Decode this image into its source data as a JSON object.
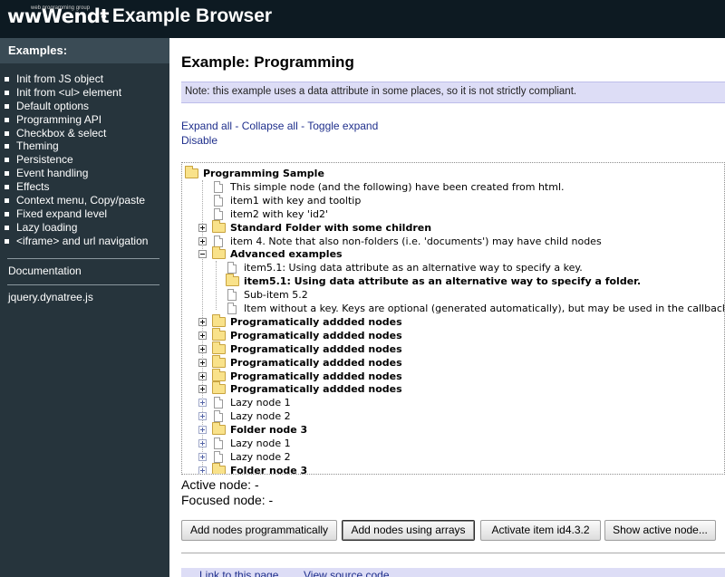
{
  "header": {
    "logo_text": "wwWendt",
    "logo_tag": "web programming group",
    "title": "- Example Browser"
  },
  "sidebar": {
    "heading": "Examples:",
    "items": [
      "Init from JS object",
      "Init from <ul> element",
      "Default options",
      "Programming API",
      "Checkbox & select",
      "Theming",
      "Persistence",
      "Event handling",
      "Effects",
      "Context menu, Copy/paste",
      "Fixed expand level",
      "Lazy loading",
      "<iframe> and url navigation"
    ],
    "documentation_link": "Documentation",
    "source_link": "jquery.dynatree.js"
  },
  "main": {
    "title": "Example: Programming",
    "note": "Note: this example uses a data attribute in some places, so it is not strictly compliant.",
    "links": {
      "expand_all": "Expand all",
      "separator": " - ",
      "collapse_all": "Collapse all",
      "toggle_expand": "Toggle expand",
      "disable": "Disable"
    },
    "tree": [
      {
        "title": "Programming Sample",
        "kind": "folder",
        "level": 0,
        "expander": "minus"
      },
      {
        "title": "This simple node (and the following) have been created from html.",
        "kind": "doc",
        "level": 1,
        "expander": "none"
      },
      {
        "title": "item1 with key and tooltip",
        "kind": "doc",
        "level": 1,
        "expander": "none"
      },
      {
        "title": "item2 with key 'id2'",
        "kind": "doc",
        "level": 1,
        "expander": "none"
      },
      {
        "title": "Standard Folder with some children",
        "kind": "folder",
        "level": 1,
        "expander": "plus"
      },
      {
        "title": "item 4. Note that also non-folders (i.e. 'documents') may have child nodes",
        "kind": "doc",
        "level": 1,
        "expander": "plus"
      },
      {
        "title": "Advanced examples",
        "kind": "folder",
        "level": 1,
        "expander": "minus"
      },
      {
        "title": "item5.1: Using data attribute as an alternative way to specify a key.",
        "kind": "doc",
        "level": 2,
        "expander": "none"
      },
      {
        "title": "item5.1: Using data attribute as an alternative way to specify a folder.",
        "kind": "folder",
        "level": 2,
        "expander": "none"
      },
      {
        "title": "Sub-item 5.2",
        "kind": "doc",
        "level": 2,
        "expander": "none"
      },
      {
        "title": "Item without a key. Keys are optional (generated automatically), but may be used in the callbacks",
        "kind": "doc",
        "level": 2,
        "expander": "none"
      },
      {
        "title": "Programatically addded nodes",
        "kind": "folder",
        "level": 1,
        "expander": "plus"
      },
      {
        "title": "Programatically addded nodes",
        "kind": "folder",
        "level": 1,
        "expander": "plus"
      },
      {
        "title": "Programatically addded nodes",
        "kind": "folder",
        "level": 1,
        "expander": "plus"
      },
      {
        "title": "Programatically addded nodes",
        "kind": "folder",
        "level": 1,
        "expander": "plus"
      },
      {
        "title": "Programatically addded nodes",
        "kind": "folder",
        "level": 1,
        "expander": "plus"
      },
      {
        "title": "Programatically addded nodes",
        "kind": "folder",
        "level": 1,
        "expander": "plus"
      },
      {
        "title": "Lazy node 1",
        "kind": "doc",
        "level": 1,
        "expander": "lazy"
      },
      {
        "title": "Lazy node 2",
        "kind": "doc",
        "level": 1,
        "expander": "lazy"
      },
      {
        "title": "Folder node 3",
        "kind": "folder",
        "level": 1,
        "expander": "lazy"
      },
      {
        "title": "Lazy node 1",
        "kind": "doc",
        "level": 1,
        "expander": "lazy"
      },
      {
        "title": "Lazy node 2",
        "kind": "doc",
        "level": 1,
        "expander": "lazy"
      },
      {
        "title": "Folder node 3",
        "kind": "folder",
        "level": 1,
        "expander": "lazy"
      }
    ],
    "active_node": "Active node: -",
    "focused_node": "Focused node: -",
    "buttons": {
      "add_programmatically": "Add nodes programmatically",
      "add_arrays": "Add nodes using arrays",
      "activate_item": "Activate item id4.3.2",
      "show_active": "Show active node..."
    },
    "footer": {
      "link_page": "Link to this page",
      "view_source": "View source code"
    }
  },
  "colors": {
    "header_bg": "#0d1a22",
    "sidebar_bg": "#26343c",
    "sidebar_heading_bg": "#3a4b55",
    "note_bg": "#ddddf6",
    "link": "#1f2f8c"
  }
}
